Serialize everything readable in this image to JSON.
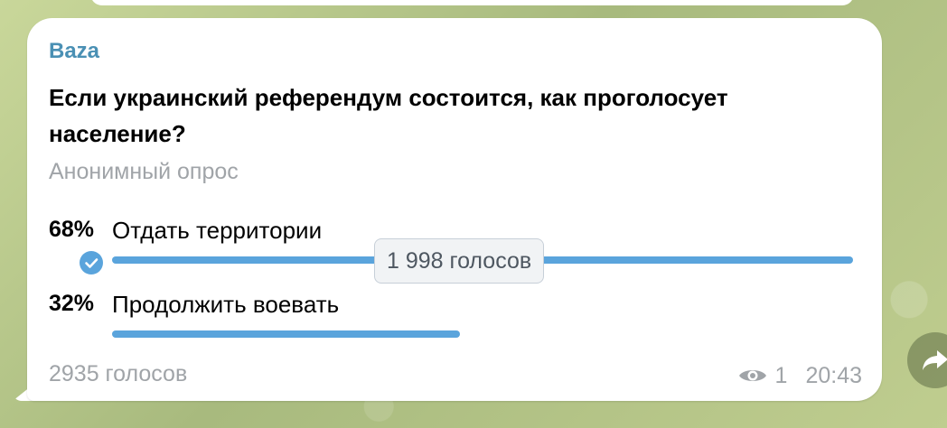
{
  "message": {
    "sender": "Baza",
    "question": "Если украинский референдум состоится, как проголосует население?",
    "poll_type": "Анонимный опрос",
    "options": [
      {
        "percent": "68%",
        "label": "Отдать территории",
        "fraction": 1.0,
        "voted": true
      },
      {
        "percent": "32%",
        "label": "Продолжить воевать",
        "fraction": 0.47,
        "voted": false
      }
    ],
    "tooltip": "1 998 голосов",
    "total_votes": "2935 голосов",
    "views": "1",
    "time": "20:43"
  },
  "colors": {
    "accent": "#5aa4dc",
    "sender": "#4a90b4",
    "muted": "#a0a4a8"
  },
  "icons": [
    "check-icon",
    "eye-icon",
    "forward-icon"
  ]
}
